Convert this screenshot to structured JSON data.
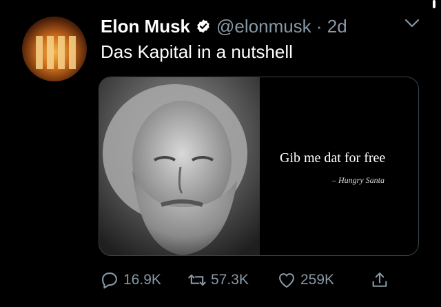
{
  "tweet": {
    "author_name": "Elon Musk",
    "handle_time": "@elonmusk · 2d",
    "text": "Das Kapital in a nutshell",
    "verified": true
  },
  "image": {
    "quote": "Gib me dat for free",
    "attribution": "– Hungry Santa"
  },
  "actions": {
    "replies": "16.9K",
    "retweets": "57.3K",
    "likes": "259K"
  },
  "colors": {
    "background": "#000000",
    "muted": "#8899a6",
    "border": "#38444d"
  }
}
